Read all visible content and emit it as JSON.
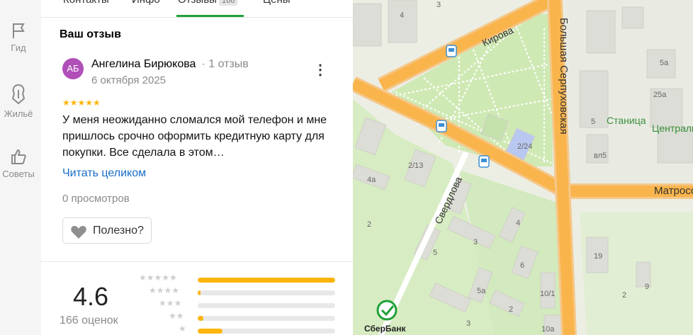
{
  "rail": {
    "items": [
      {
        "label": "Гид",
        "icon": "flag-icon"
      },
      {
        "label": "Жильё",
        "icon": "house-icon"
      },
      {
        "label": "Советы",
        "icon": "thumb-up-icon"
      }
    ]
  },
  "tabs": [
    {
      "label": "Контакты"
    },
    {
      "label": "Инфо"
    },
    {
      "label": "Отзывы",
      "count": "166"
    },
    {
      "label": "Цены"
    }
  ],
  "review": {
    "heading": "Ваш отзыв",
    "avatar_initials": "АБ",
    "author": "Ангелина Бирюкова",
    "author_reviews": "· 1 отзыв",
    "date": "6 октября 2025",
    "stars": 5,
    "text": "У меня неожиданно сломался мой телефон и мне пришлось срочно оформить кредитную карту для покупки. Все сделала в этом…",
    "read_more": "Читать целиком",
    "views": "0 просмотров",
    "helpful_label": "Полезно?"
  },
  "rating": {
    "value": "4.6",
    "count_label": "166 оценок",
    "histogram": [
      {
        "stars": 5,
        "fraction": 1.0
      },
      {
        "stars": 4,
        "fraction": 0.02
      },
      {
        "stars": 3,
        "fraction": 0.0
      },
      {
        "stars": 2,
        "fraction": 0.04
      },
      {
        "stars": 1,
        "fraction": 0.18
      }
    ]
  },
  "map": {
    "labels": {
      "kirova": "Кирова",
      "bolshaya_serpukhovskaya": "Большая Серпуховская",
      "sverdlova": "Свердлова",
      "matrosova": "Матросо",
      "stanitsa": "Станица",
      "centralny": "Центральн",
      "sberbank": "СберБанк"
    },
    "house_numbers": [
      "4",
      "3",
      "5а",
      "25а",
      "5",
      "вл5",
      "2/13",
      "2/24",
      "4а",
      "4",
      "3",
      "5",
      "6",
      "19",
      "5а",
      "10/1",
      "2",
      "10а",
      "9",
      "3",
      "2",
      "2"
    ],
    "colors": {
      "major_road": "#f9b54c",
      "park": "#cfe9b4",
      "accent": "#21a038"
    }
  }
}
